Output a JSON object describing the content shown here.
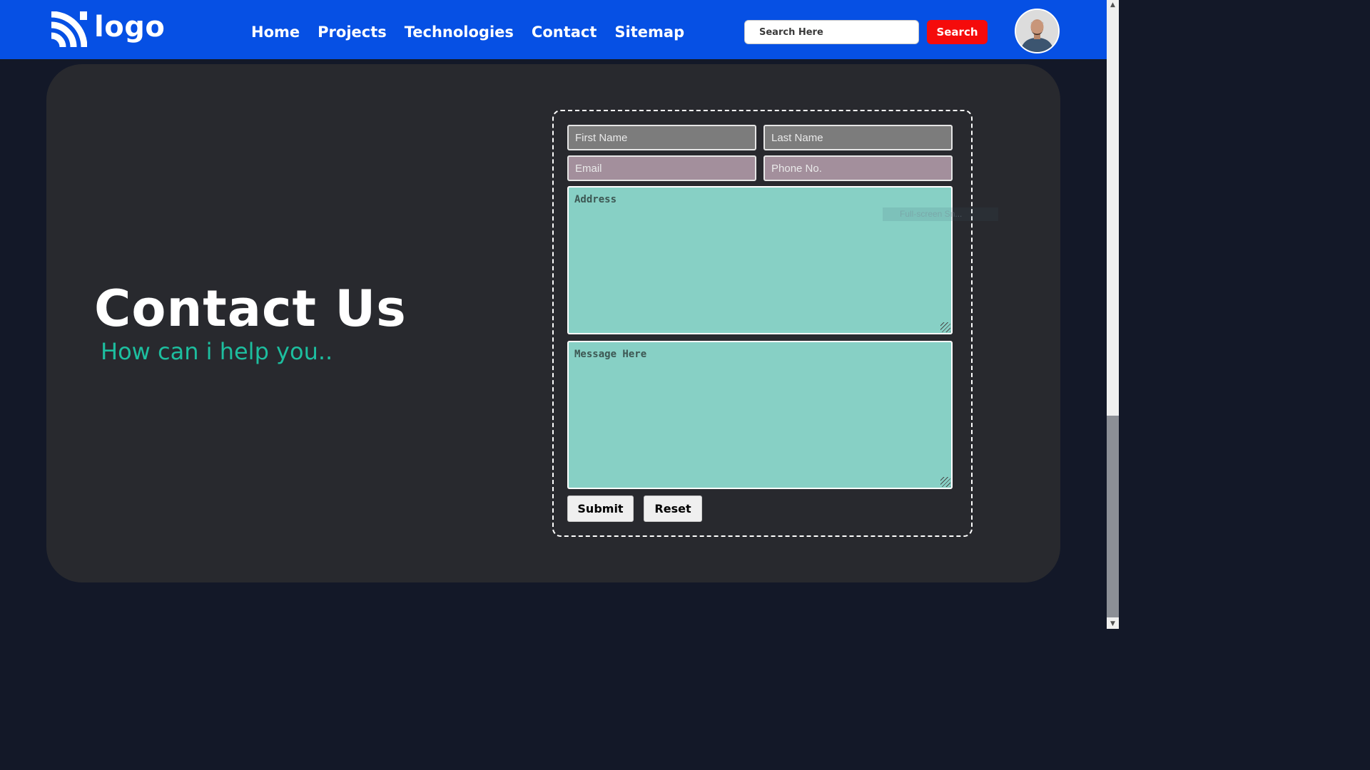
{
  "header": {
    "logo_text": "logo",
    "nav": [
      {
        "label": "Home"
      },
      {
        "label": "Projects"
      },
      {
        "label": "Technologies"
      },
      {
        "label": "Contact"
      },
      {
        "label": "Sitemap"
      }
    ],
    "search": {
      "placeholder": "Search Here",
      "button_label": "Search"
    },
    "avatar_icon": "user-avatar"
  },
  "main": {
    "title": "Contact Us",
    "subtitle": "How can i help you.."
  },
  "form": {
    "first_name": {
      "placeholder": "First Name",
      "value": ""
    },
    "last_name": {
      "placeholder": "Last Name",
      "value": ""
    },
    "email": {
      "placeholder": "Email",
      "value": ""
    },
    "phone": {
      "placeholder": "Phone No.",
      "value": ""
    },
    "address": {
      "placeholder": "Address",
      "value": ""
    },
    "message": {
      "placeholder": "Message Here",
      "value": ""
    },
    "submit_label": "Submit",
    "reset_label": "Reset"
  },
  "overlay": {
    "fullscreen_hint": "Full-screen Sn..."
  },
  "colors": {
    "header_bg": "#0650e4",
    "page_bg": "#131828",
    "card_bg": "#28292e",
    "accent_teal": "#1dbe9f",
    "search_button": "#f50b0b",
    "textarea_bg": "#87d0c5"
  }
}
